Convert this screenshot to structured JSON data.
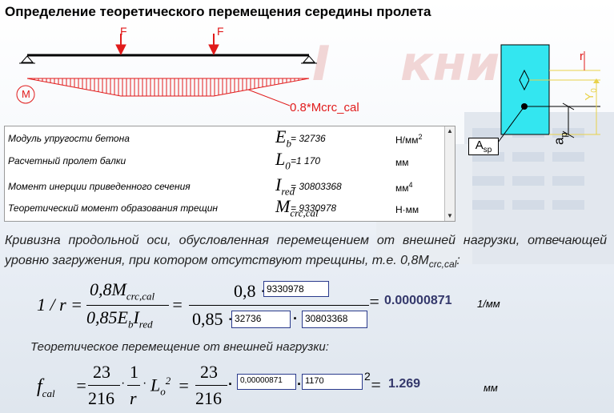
{
  "title": "Определение теоретического перемещения середины пролета",
  "beam": {
    "force_label": "F",
    "moment_label": "M",
    "moment_diagram_label": "0.8*Mcrc_cal"
  },
  "section": {
    "r_label": "r",
    "y0_label": "Y",
    "y0_sub": "0",
    "asp_label": "A",
    "asp_sub": "sp",
    "ap_label": "a",
    "ap_sub": "p"
  },
  "params": [
    {
      "label": "Модуль упругости бетона",
      "sym": "E",
      "sub": "b",
      "val": "= 32736",
      "unit": "Н/мм",
      "unit_sup": "2"
    },
    {
      "label": "Расчетный пролет балки",
      "sym": "L",
      "sub": "0",
      "val": "=1 170",
      "unit": "мм",
      "unit_sup": ""
    },
    {
      "label": "Момент инерции приведенного сечения",
      "sym": "I",
      "sub": "red",
      "val": "= 30803368",
      "unit": "мм",
      "unit_sup": "4"
    },
    {
      "label": "Теоретический момент образования трещин",
      "sym": "M",
      "sub": "crc,cal",
      "val": "= 9330978",
      "unit": "Н·мм",
      "unit_sup": ""
    }
  ],
  "paragraph": "Кривизна продольной оси, обусловленная перемещением от внешней нагрузки, отвечающей уровню загружения, при котором отсутствуют трещины, т.е. 0,8M",
  "paragraph_sub": "crc,cal",
  "paragraph_end": ":",
  "curvature": {
    "lhs": "1 / r =",
    "num": "0,8M",
    "num_sub": "crc,cal",
    "den": "0,85E",
    "den_sub1": "b",
    "den_mid": "I",
    "den_sub2": "red",
    "eq": "=",
    "num2": "0,8 ·",
    "mcrc_input": "9330978",
    "den2": "0,85 ·",
    "eb_input": "32736",
    "ired_input": "30803368",
    "dot": "·",
    "eq2": "=",
    "result": "0.00000871",
    "unit": "1/мм"
  },
  "subtitle": "Теоретическое перемещение от внешней нагрузки:",
  "deflection": {
    "lhs": "f",
    "lhs_sub": "cal",
    "eq": "=",
    "frac_num": "23",
    "frac_den": "216",
    "one": "1",
    "r": "r",
    "L": "L",
    "L_sub": "o",
    "L_sup": "2",
    "num2": "23",
    "den2": "216",
    "curv_input": "0,00000871",
    "len_input": "1170",
    "sup2": "2",
    "eq2": "=",
    "result": "1.269",
    "unit": "мм"
  },
  "colors": {
    "red": "#e11b1b",
    "section_fill": "#33e6f0",
    "box_border": "#2a3a8c",
    "result": "#34386b",
    "yellow": "#e8d24a"
  }
}
